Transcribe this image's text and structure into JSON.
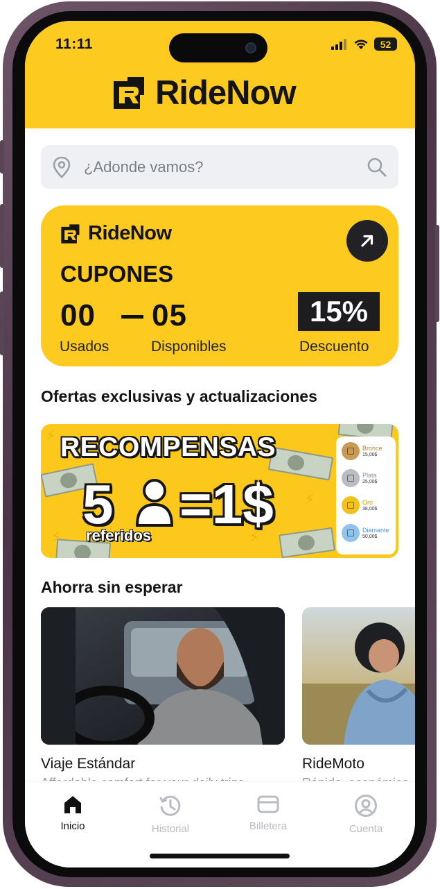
{
  "status": {
    "time": "11:11",
    "battery": "52"
  },
  "brand": {
    "name": "RideNow"
  },
  "search": {
    "placeholder": "¿Adonde vamos?"
  },
  "coupon": {
    "brand": "RideNow",
    "title": "CUPONES",
    "used_value": "00",
    "available_value": "05",
    "discount_value": "15%",
    "used_label": "Usados",
    "available_label": "Disponibles",
    "discount_label": "Descuento"
  },
  "offers": {
    "section_title": "Ofertas exclusivas y actualizaciones",
    "banner": {
      "headline": "RECOMPENSAS",
      "left_number": "5",
      "right_value": "=1$",
      "referrals_label": "referidos",
      "tiers": [
        {
          "name": "Bronce",
          "amount": "15,00$",
          "color": "#c99a55",
          "text_color": "#b98437"
        },
        {
          "name": "Plata",
          "amount": "25,00$",
          "color": "#b9bcc0",
          "text_color": "#8b8f94"
        },
        {
          "name": "Oro",
          "amount": "38,00$",
          "color": "#f2c21a",
          "text_color": "#d9a50b"
        },
        {
          "name": "Diamante",
          "amount": "50,00$",
          "color": "#8fc3ec",
          "text_color": "#4f97cf"
        }
      ]
    }
  },
  "rides": {
    "section_title": "Ahorra sin esperar",
    "cards": [
      {
        "title": "Viaje Estándar",
        "subtitle": "Affordable comfort for your daily trips"
      },
      {
        "title": "RideMoto",
        "subtitle": "Rápido, económico"
      }
    ]
  },
  "tabs": [
    {
      "label": "Inicio",
      "icon": "home-icon",
      "active": true
    },
    {
      "label": "Historial",
      "icon": "history-icon",
      "active": false
    },
    {
      "label": "Billetera",
      "icon": "wallet-icon",
      "active": false
    },
    {
      "label": "Cuenta",
      "icon": "account-icon",
      "active": false
    }
  ],
  "colors": {
    "accent": "#fdca20",
    "dark": "#141414",
    "muted": "#b8bcc2"
  }
}
